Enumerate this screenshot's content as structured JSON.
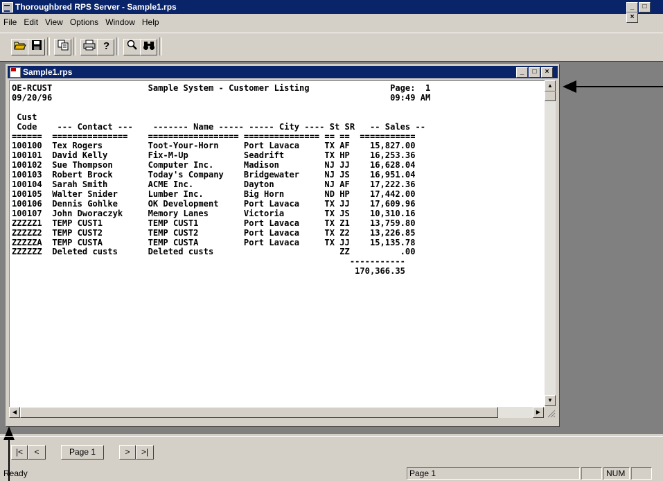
{
  "app": {
    "title": "Thoroughbred RPS Server - Sample1.rps",
    "caption_buttons": [
      "_",
      "□",
      "×"
    ]
  },
  "menu": [
    "File",
    "Edit",
    "View",
    "Options",
    "Window",
    "Help"
  ],
  "toolbar": {
    "buttons": [
      "open-folder-icon",
      "save-disk-icon",
      "copy-icon",
      "print-icon",
      "help-icon",
      "zoom-icon",
      "find-binoculars-icon"
    ]
  },
  "child_window": {
    "title": "Sample1.rps",
    "caption_buttons": [
      "_",
      "□",
      "×"
    ]
  },
  "report": {
    "program_id": "OE-RCUST",
    "date": "09/20/96",
    "title": "Sample System - Customer Listing",
    "page_label": "Page:",
    "page_number": "1",
    "time": "09:49 AM",
    "header_line1": "Cust",
    "header_line2": "Code    --- Contact ---    ------- Name ----- ----- City ---- St SR   -- Sales --",
    "header_rule": "======  ===============    ================== =============== == ==  ===========",
    "rows": [
      {
        "code": "100100",
        "contact": "Tex Rogers",
        "name": "Toot-Your-Horn",
        "city": "Port Lavaca",
        "st": "TX",
        "sr": "AF",
        "sales": "15,827.00"
      },
      {
        "code": "100101",
        "contact": "David Kelly",
        "name": "Fix-M-Up",
        "city": "Seadrift",
        "st": "TX",
        "sr": "HP",
        "sales": "16,253.36"
      },
      {
        "code": "100102",
        "contact": "Sue Thompson",
        "name": "Computer Inc.",
        "city": "Madison",
        "st": "NJ",
        "sr": "JJ",
        "sales": "16,628.04"
      },
      {
        "code": "100103",
        "contact": "Robert Brock",
        "name": "Today's Company",
        "city": "Bridgewater",
        "st": "NJ",
        "sr": "JS",
        "sales": "16,951.04"
      },
      {
        "code": "100104",
        "contact": "Sarah Smith",
        "name": "ACME Inc.",
        "city": "Dayton",
        "st": "NJ",
        "sr": "AF",
        "sales": "17,222.36"
      },
      {
        "code": "100105",
        "contact": "Walter Snider",
        "name": "Lumber Inc.",
        "city": "Big Horn",
        "st": "ND",
        "sr": "HP",
        "sales": "17,442.00"
      },
      {
        "code": "100106",
        "contact": "Dennis Gohlke",
        "name": "OK Development",
        "city": "Port Lavaca",
        "st": "TX",
        "sr": "JJ",
        "sales": "17,609.96"
      },
      {
        "code": "100107",
        "contact": "John Dworaczyk",
        "name": "Memory Lanes",
        "city": "Victoria",
        "st": "TX",
        "sr": "JS",
        "sales": "10,310.16"
      },
      {
        "code": "ZZZZZ1",
        "contact": "TEMP CUST1",
        "name": "TEMP CUST1",
        "city": "Port Lavaca",
        "st": "TX",
        "sr": "Z1",
        "sales": "13,759.80"
      },
      {
        "code": "ZZZZZ2",
        "contact": "TEMP CUST2",
        "name": "TEMP CUST2",
        "city": "Port Lavaca",
        "st": "TX",
        "sr": "Z2",
        "sales": "13,226.85"
      },
      {
        "code": "ZZZZZA",
        "contact": "TEMP CUSTA",
        "name": "TEMP CUSTA",
        "city": "Port Lavaca",
        "st": "TX",
        "sr": "JJ",
        "sales": "15,135.78"
      },
      {
        "code": "ZZZZZZ",
        "contact": "Deleted custs",
        "name": "Deleted custs",
        "city": "",
        "st": "",
        "sr": "ZZ",
        "sales": ".00"
      }
    ],
    "total_rule": "-----------",
    "total": "170,366.35"
  },
  "navigation": {
    "first": "|<",
    "prev": "<",
    "page": "Page 1",
    "next": ">",
    "last": ">|"
  },
  "status": {
    "ready": "Ready",
    "page": "Page 1",
    "num": "NUM"
  }
}
